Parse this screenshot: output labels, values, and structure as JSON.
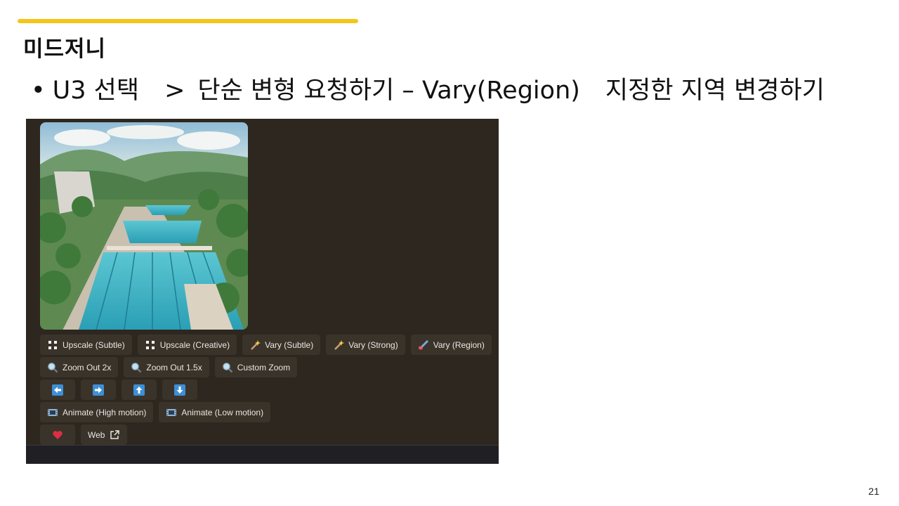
{
  "slide": {
    "title": "미드저니",
    "bullet": {
      "part1": "U3 선택",
      "part2": ">",
      "part3": "단순 변형 요청하기 – Vary(Region)",
      "part4": "지정한 지역 변경하기"
    },
    "page_number": "21",
    "accent_color": "#f5c518"
  },
  "midjourney": {
    "image_alt": "AI-generated illustration of a large outdoor swimming pool complex in a green valley",
    "row1": [
      {
        "label": "Upscale (Subtle)",
        "icon": "expand-icon"
      },
      {
        "label": "Upscale (Creative)",
        "icon": "expand-icon"
      },
      {
        "label": "Vary (Subtle)",
        "icon": "magic-wand-icon"
      },
      {
        "label": "Vary (Strong)",
        "icon": "magic-wand-icon"
      },
      {
        "label": "Vary (Region)",
        "icon": "paintbrush-icon"
      }
    ],
    "row2": [
      {
        "label": "Zoom Out 2x",
        "icon": "magnifier-icon"
      },
      {
        "label": "Zoom Out 1.5x",
        "icon": "magnifier-icon"
      },
      {
        "label": "Custom Zoom",
        "icon": "magnifier-icon"
      }
    ],
    "row3": [
      {
        "icon": "arrow-left-icon"
      },
      {
        "icon": "arrow-right-icon"
      },
      {
        "icon": "arrow-up-icon"
      },
      {
        "icon": "arrow-down-icon"
      }
    ],
    "row4": [
      {
        "label": "Animate (High motion)",
        "icon": "film-icon"
      },
      {
        "label": "Animate (Low motion)",
        "icon": "film-icon"
      }
    ],
    "row5": [
      {
        "icon": "heart-icon"
      },
      {
        "label": "Web",
        "icon": "external-link-icon"
      }
    ],
    "colors": {
      "panel_bg": "#2e2720",
      "button_bg": "#3a332a",
      "button_text": "#e8e6e3",
      "arrow_blue": "#3d8fd6",
      "heart_red": "#dd2e44"
    }
  }
}
